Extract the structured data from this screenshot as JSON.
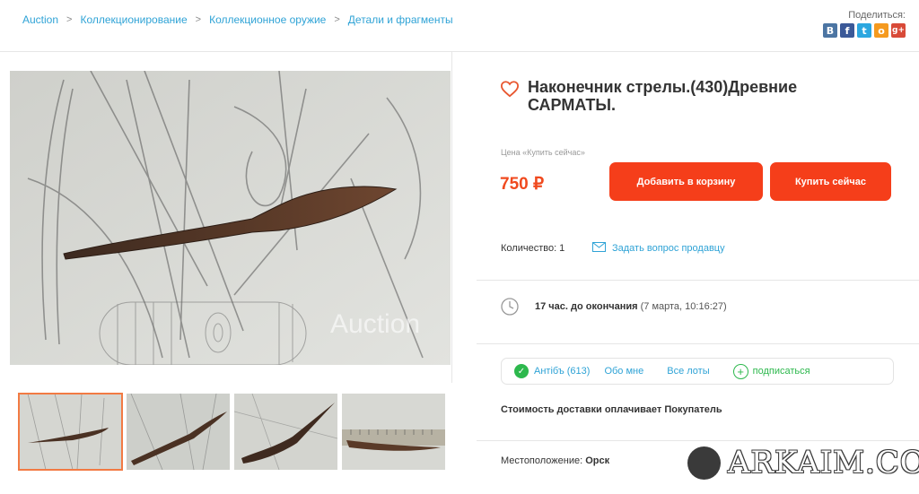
{
  "breadcrumb": [
    {
      "label": "Auction"
    },
    {
      "label": "Коллекционирование"
    },
    {
      "label": "Коллекционное оружие"
    },
    {
      "label": "Детали и фрагменты"
    }
  ],
  "share": {
    "label": "Поделиться:",
    "icons": [
      {
        "name": "vk-icon",
        "glyph": "В",
        "color": "#4c75a3"
      },
      {
        "name": "facebook-icon",
        "glyph": "f",
        "color": "#3b5998"
      },
      {
        "name": "twitter-icon",
        "glyph": "t",
        "color": "#2ca7e0"
      },
      {
        "name": "odnoklassniki-icon",
        "glyph": "о",
        "color": "#f59a1f"
      },
      {
        "name": "google-plus-icon",
        "glyph": "g+",
        "color": "#d84a38"
      }
    ]
  },
  "photo": {
    "watermark": "Auction"
  },
  "lot": {
    "title": "Наконечник стрелы.(430)Древние САРМАТЫ.",
    "price_label": "Цена «Купить сейчас»",
    "price": "750 ₽",
    "add_to_cart": "Добавить в корзину",
    "buy_now": "Купить сейчас",
    "quantity": "Количество: 1",
    "ask_seller": "Задать вопрос продавцу"
  },
  "timer": {
    "remaining": "17 час. до окончания",
    "end": "(7 марта, 10:16:27)"
  },
  "seller": {
    "name": "Антібъ (613)",
    "about": "Обо мне",
    "all_lots": "Все лоты",
    "subscribe": "подписаться"
  },
  "delivery": "Стоимость доставки оплачивает Покупатель",
  "location": {
    "label": "Местоположение:",
    "value": "Орск"
  },
  "brand": "ARKAIM.CO",
  "colors": {
    "accent": "#f53e1a",
    "link": "#2fa3d6",
    "success": "#2db84d",
    "price": "#f04a1f"
  }
}
